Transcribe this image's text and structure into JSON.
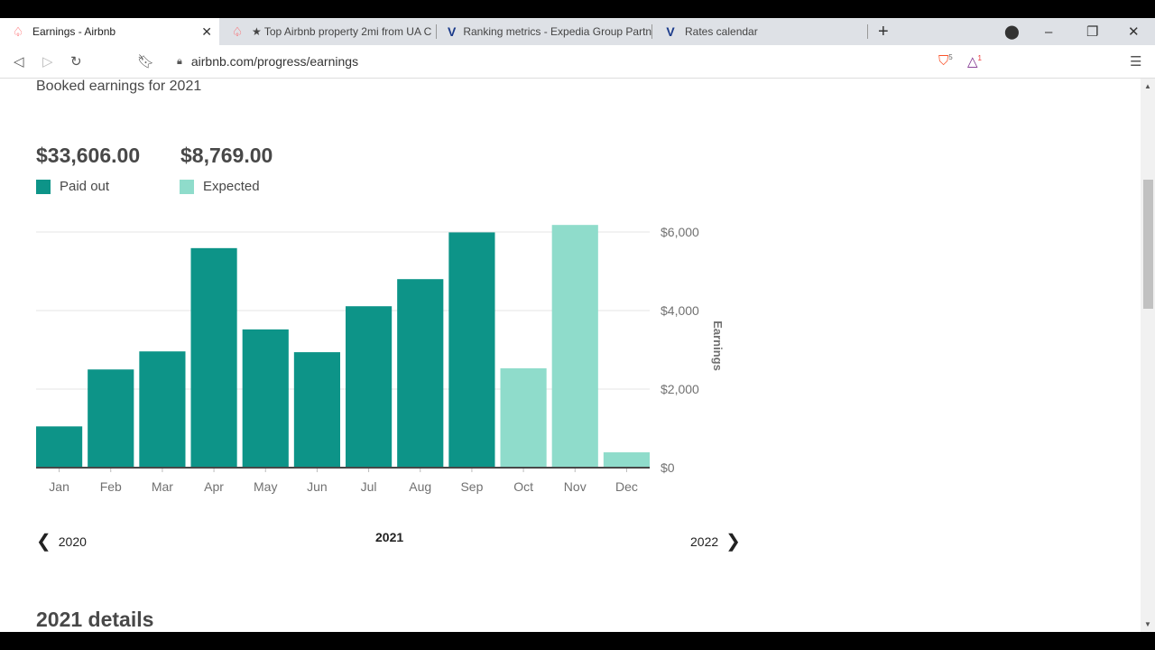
{
  "browser": {
    "tabs": [
      {
        "title": "Earnings - Airbnb",
        "icon": "airbnb-icon",
        "active": true
      },
      {
        "title": "★ Top Airbnb property 2mi from UA C",
        "icon": "airbnb-icon"
      },
      {
        "title": "Ranking metrics - Expedia Group Partn",
        "icon": "vrbo-icon"
      },
      {
        "title": "Rates calendar",
        "icon": "vrbo-icon"
      }
    ],
    "url": "airbnb.com/progress/earnings",
    "brave_badge": "5",
    "rewards_badge": "1"
  },
  "page": {
    "heading": "Booked earnings for 2021",
    "paid_total": "$33,606.00",
    "expected_total": "$8,769.00",
    "nav": {
      "prev": "2020",
      "current": "2021",
      "next": "2022"
    },
    "details_heading": "2021 details"
  },
  "colors": {
    "paid": "#0d9488",
    "expected": "#8fdccb"
  },
  "chart_data": {
    "type": "bar",
    "categories": [
      "Jan",
      "Feb",
      "Mar",
      "Apr",
      "May",
      "Jun",
      "Jul",
      "Aug",
      "Sep",
      "Oct",
      "Nov",
      "Dec"
    ],
    "series": [
      {
        "name": "Paid out",
        "values": [
          1050,
          2500,
          2960,
          5590,
          3520,
          2940,
          4110,
          4800,
          5990,
          0,
          0,
          0
        ]
      },
      {
        "name": "Expected",
        "values": [
          0,
          0,
          0,
          0,
          0,
          0,
          0,
          0,
          0,
          2530,
          6180,
          390
        ]
      }
    ],
    "ylabel": "Earnings",
    "yticks": [
      "$0",
      "$2,000",
      "$4,000",
      "$6,000"
    ],
    "ytick_values": [
      0,
      2000,
      4000,
      6000
    ],
    "ylim": [
      0,
      6000
    ],
    "grid": true,
    "legend": "top-left"
  }
}
